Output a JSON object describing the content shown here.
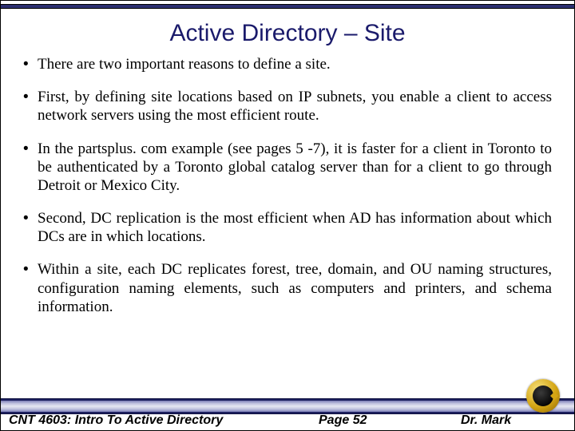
{
  "title": "Active Directory – Site",
  "bullets": [
    "There are two important reasons to define a site.",
    "First, by defining site locations based on IP subnets, you enable a client to access network servers using the most efficient route.",
    "In the partsplus. com example (see pages 5 -7), it is faster for a client in Toronto to be authenticated by a Toronto global catalog server than for a client to go through Detroit or Mexico City.",
    "Second, DC replication is the most efficient when AD has information about which DCs are in which locations.",
    "Within a site, each DC replicates forest, tree, domain, and OU naming structures, configuration naming elements, such as computers and printers, and schema information."
  ],
  "footer": {
    "course": "CNT 4603: Intro To Active Directory",
    "page": "Page 52",
    "author": "Dr. Mark"
  }
}
